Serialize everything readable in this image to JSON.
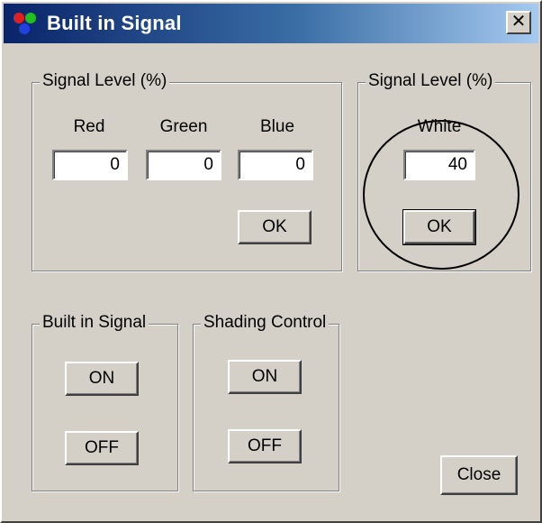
{
  "window": {
    "title": "Built in Signal",
    "close_glyph": "✕"
  },
  "rgb_group": {
    "legend": "Signal Level (%)",
    "red_label": "Red",
    "green_label": "Green",
    "blue_label": "Blue",
    "red_value": "0",
    "green_value": "0",
    "blue_value": "0",
    "ok_label": "OK"
  },
  "white_group": {
    "legend": "Signal Level (%)",
    "white_label": "White",
    "white_value": "40",
    "ok_label": "OK"
  },
  "builtin_group": {
    "legend": "Built in Signal",
    "on_label": "ON",
    "off_label": "OFF"
  },
  "shading_group": {
    "legend": "Shading Control",
    "on_label": "ON",
    "off_label": "OFF"
  },
  "close_button": {
    "label": "Close"
  },
  "icons": {
    "title_icon": "rgb-dots-icon",
    "close_icon": "close-icon"
  },
  "colors": {
    "titlebar_start": "#0a246a",
    "titlebar_end": "#a6caf0",
    "dialog_bg": "#d4d0c8"
  }
}
